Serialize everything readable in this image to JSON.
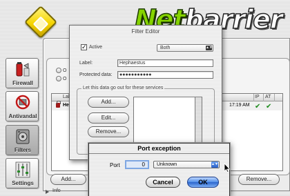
{
  "brand": {
    "word1": "Net",
    "word2": "barrier"
  },
  "sidebar": {
    "items": [
      {
        "label": "Firewall",
        "icon": "firewall-icon"
      },
      {
        "label": "Antivandal",
        "icon": "antivandal-icon"
      },
      {
        "label": "Filters",
        "icon": "filters-icon",
        "selected": true
      },
      {
        "label": "Settings",
        "icon": "settings-icon"
      }
    ]
  },
  "main": {
    "radio_options": [
      "O",
      "O"
    ],
    "list": {
      "header_label": "Lal",
      "header_ip": "IP",
      "header_at": "AT",
      "row": {
        "name": "He",
        "time": "17:19 AM"
      }
    },
    "add_button": "Add...",
    "remove_button": "Remove...",
    "footer_info": "Info"
  },
  "filter_editor": {
    "title": "Filter Editor",
    "active_label": "Active",
    "active_checked": true,
    "direction_value": "Both",
    "label_caption": "Label:",
    "label_value": "Hephaestus",
    "protected_caption": "Protected data:",
    "protected_value": "●●●●●●●●●●●",
    "group_title": "Let this data go out for these services",
    "add_button": "Add...",
    "edit_button": "Edit...",
    "remove_button": "Remove..."
  },
  "port_exception": {
    "title": "Port exception",
    "port_label": "Port",
    "port_value": "0",
    "service_value": "Unknown",
    "cancel_label": "Cancel",
    "ok_label": "OK"
  },
  "colors": {
    "accent": "#4f8ce6",
    "brand_green": "#86d400",
    "lock_red": "#a01818",
    "check_green": "#1a8a1a"
  }
}
